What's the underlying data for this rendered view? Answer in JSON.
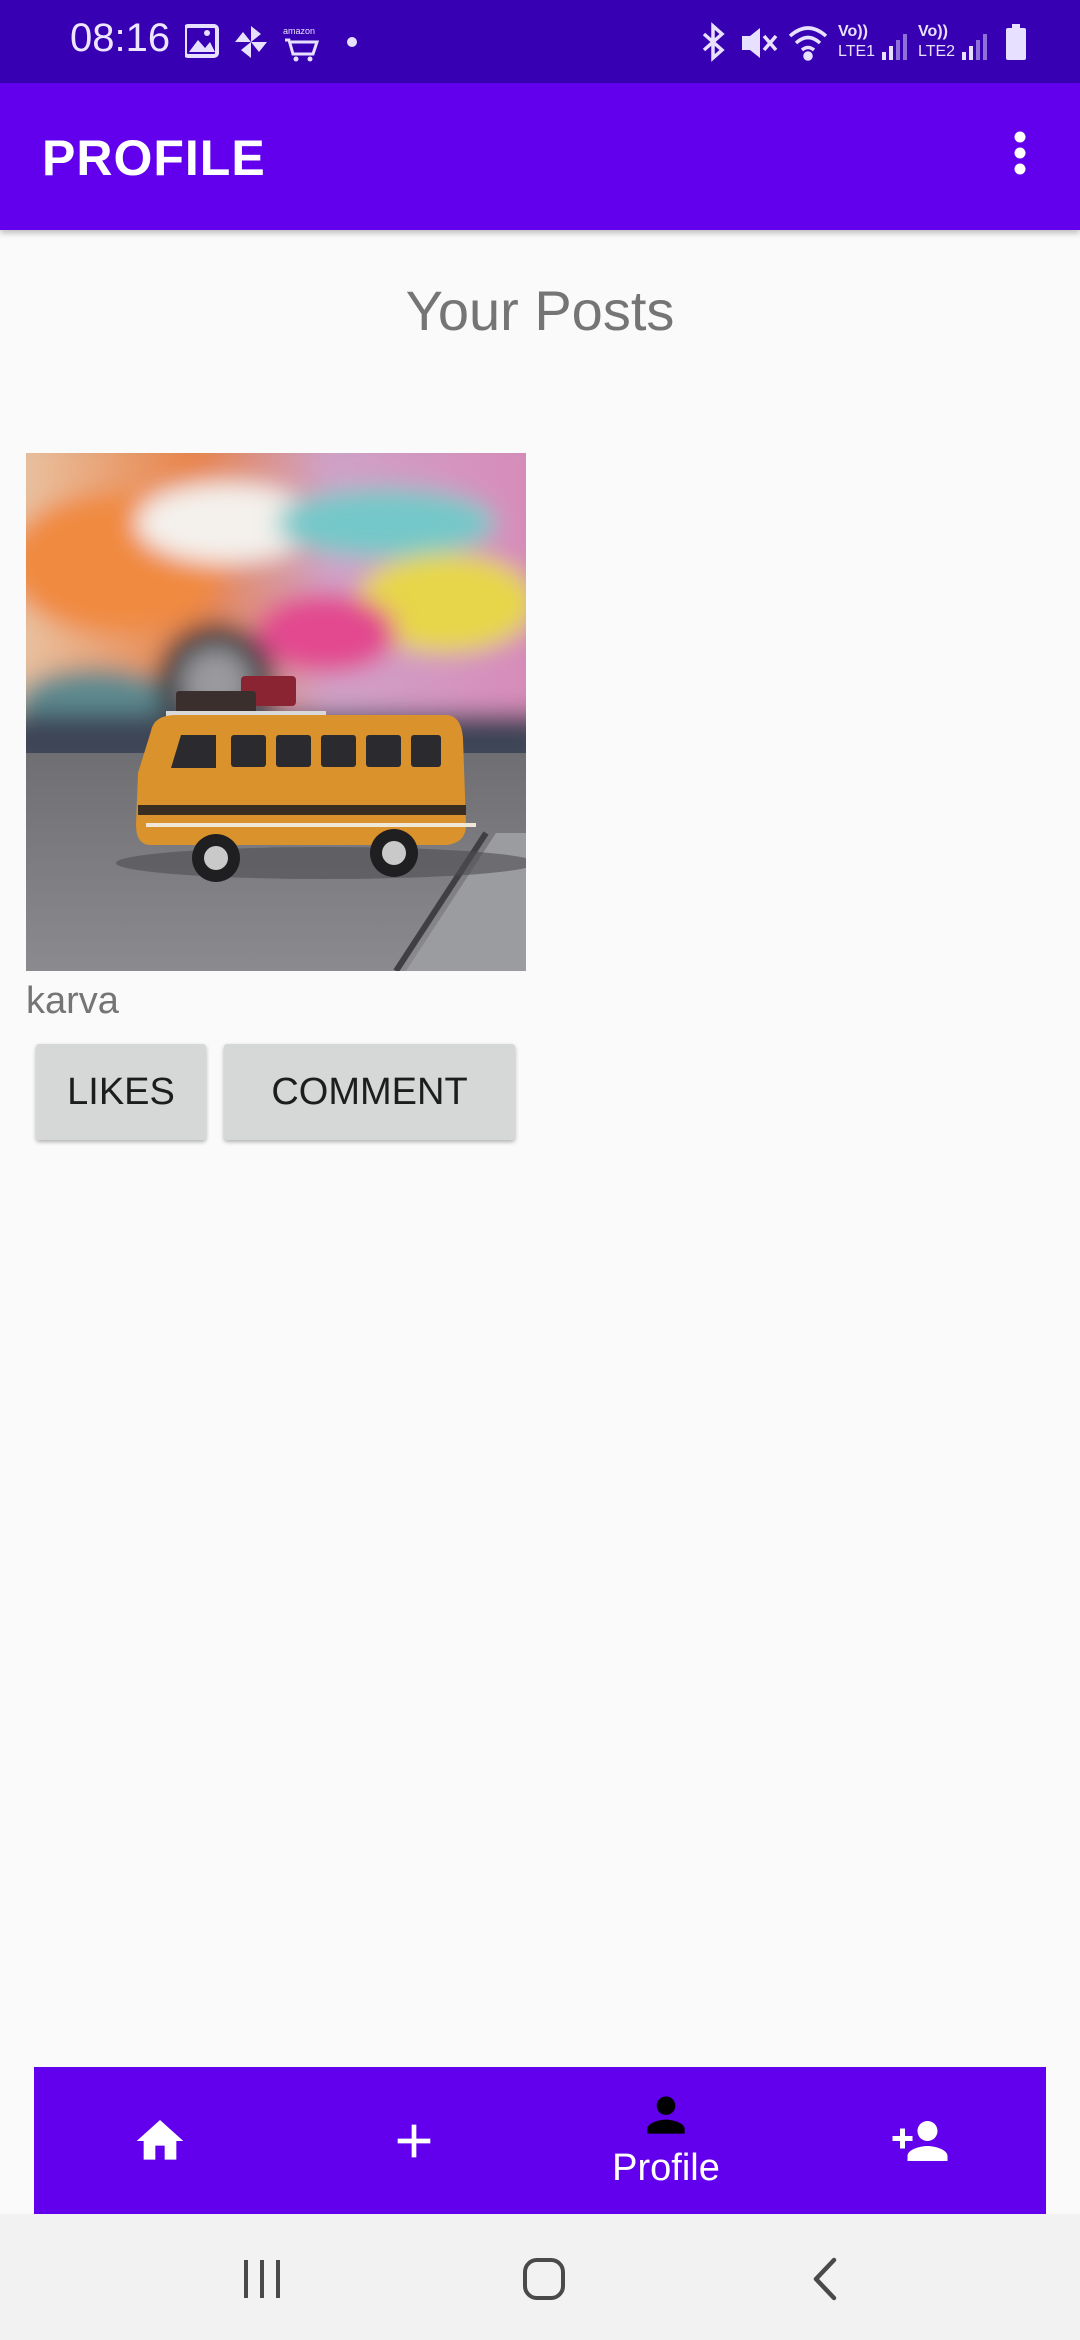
{
  "status_bar": {
    "time": "08:16",
    "left_icons": [
      "image-icon",
      "pinwheel-icon",
      "amazon-icon",
      "dot-icon"
    ],
    "right_icons": [
      "bluetooth-icon",
      "mute-icon",
      "wifi-icon",
      "lte1-signal-icon",
      "lte2-signal-icon",
      "battery-icon"
    ],
    "lte1_label": "LTE1",
    "lte2_label": "LTE2",
    "volte_label": "Vo))",
    "colors": {
      "background": "#3700b3"
    }
  },
  "app_bar": {
    "title": "PROFILE",
    "menu_icon": "more-vert-icon",
    "color": "#6200ee"
  },
  "main": {
    "section_title": "Your Posts",
    "posts": [
      {
        "image": "toy-van-photo",
        "username": "karva",
        "likes_label": "LIKES",
        "comment_label": "COMMENT"
      }
    ]
  },
  "bottom_nav": {
    "color": "#6200ee",
    "items": [
      {
        "icon": "home-icon",
        "label": ""
      },
      {
        "icon": "add-icon",
        "label": ""
      },
      {
        "icon": "person-icon",
        "label": "Profile",
        "selected": true
      },
      {
        "icon": "person-add-icon",
        "label": ""
      }
    ]
  },
  "system_nav": {
    "buttons": [
      "recents-icon",
      "home-circle-icon",
      "back-icon"
    ]
  }
}
